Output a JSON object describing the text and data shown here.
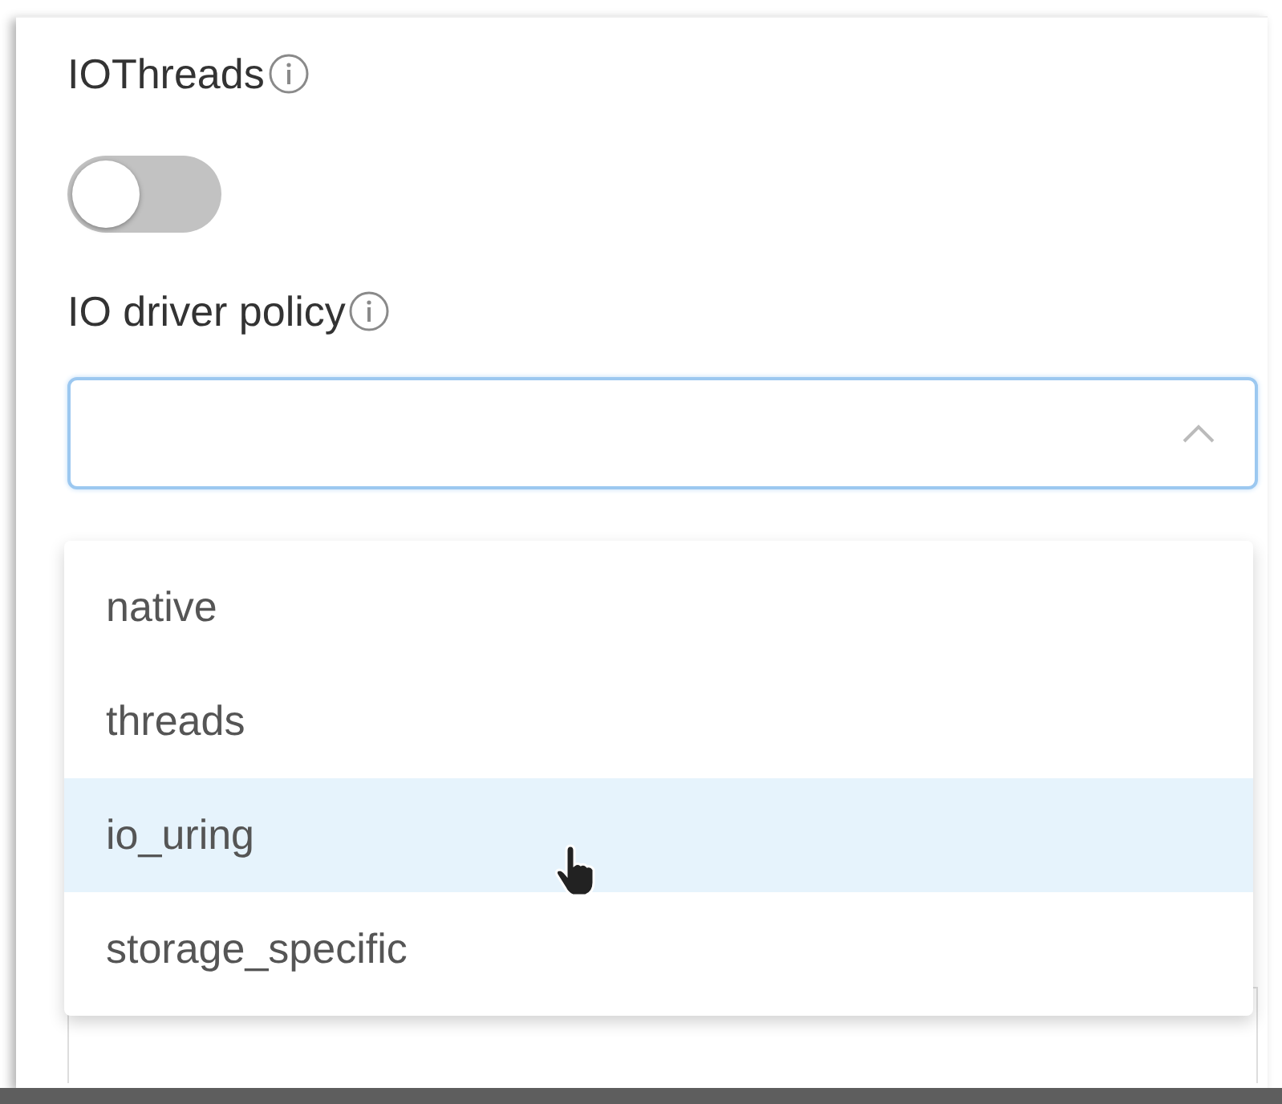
{
  "io_threads": {
    "label": "IOThreads",
    "on": false
  },
  "io_driver_policy": {
    "label": "IO driver policy",
    "expanded": true,
    "options": [
      {
        "label": "native",
        "highlighted": false
      },
      {
        "label": "threads",
        "highlighted": false
      },
      {
        "label": "io_uring",
        "highlighted": true
      },
      {
        "label": "storage_specific",
        "highlighted": false
      }
    ]
  }
}
